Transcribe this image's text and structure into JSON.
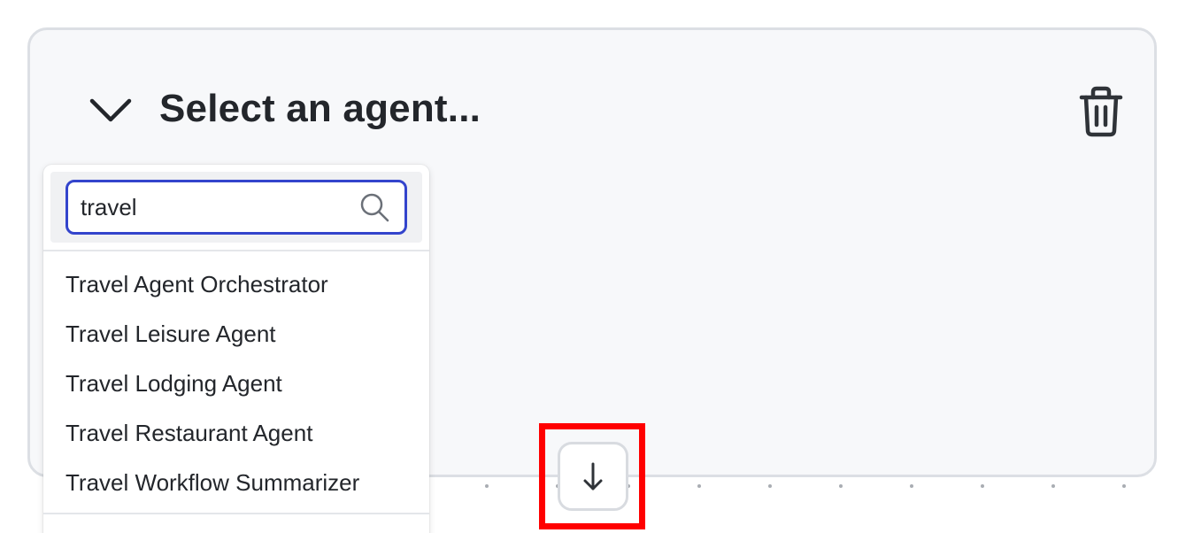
{
  "header": {
    "title": "Select an agent..."
  },
  "icons": {
    "collapse": "chevron-down-icon",
    "delete": "trash-icon",
    "search": "search-icon",
    "scroll": "arrow-down-icon"
  },
  "search": {
    "value": "travel",
    "placeholder": ""
  },
  "results": [
    {
      "label": "Travel Agent Orchestrator"
    },
    {
      "label": "Travel Leisure Agent"
    },
    {
      "label": "Travel Lodging Agent"
    },
    {
      "label": "Travel Restaurant Agent"
    },
    {
      "label": "Travel Workflow Summarizer"
    }
  ],
  "colors": {
    "focus_border": "#3344cc",
    "card_background": "#f7f8fa",
    "text": "#23262b",
    "highlight": "#ff0000"
  }
}
